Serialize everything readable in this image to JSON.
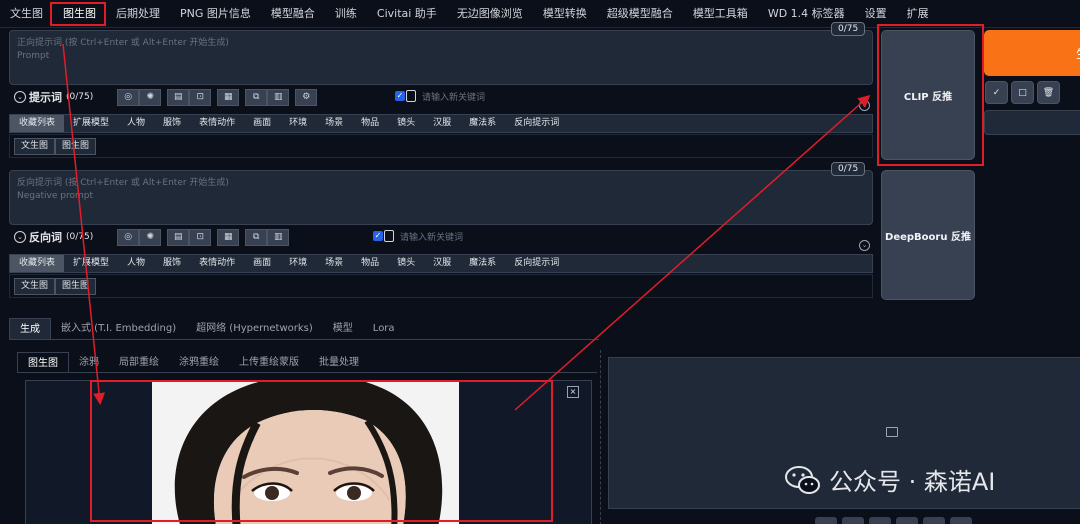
{
  "top_nav": {
    "tabs": [
      "文生图",
      "图生图",
      "后期处理",
      "PNG 图片信息",
      "模型融合",
      "训练",
      "Civitai 助手",
      "无边图像浏览",
      "模型转换",
      "超级模型融合",
      "模型工具箱",
      "WD 1.4 标签器",
      "设置",
      "扩展"
    ],
    "active_index": 1
  },
  "positive": {
    "placeholder": "正向提示词 (按 Ctrl+Enter 或 Alt+Enter 开始生成)",
    "sub_label": "Prompt",
    "counter": "0/75",
    "label": "提示词",
    "count": "(0/75)",
    "keyword_placeholder": "请输入新关键词"
  },
  "negative": {
    "placeholder": "反向提示词 (按 Ctrl+Enter 或 Alt+Enter 开始生成)",
    "sub_label": "Negative prompt",
    "counter": "0/75",
    "label": "反向词",
    "count": "(0/75)",
    "keyword_placeholder": "请输入新关键词"
  },
  "tag_categories": [
    "收藏列表",
    "扩展模型",
    "人物",
    "服饰",
    "表情动作",
    "画面",
    "环境",
    "场景",
    "物品",
    "镜头",
    "汉服",
    "魔法系",
    "反向提示词"
  ],
  "sub_tags": [
    "文生图",
    "图生图"
  ],
  "toolbar_icons": [
    "globe-icon",
    "gear-icon",
    "notes-icon",
    "bookmark-icon",
    "translate-icon",
    "copy-icon",
    "trash-icon",
    "settings-icon"
  ],
  "interrogate": {
    "clip_label": "CLIP 反推",
    "deepbooru_label": "DeepBooru 反推"
  },
  "generate_button_text": "生",
  "action_icons": [
    "✓",
    "□",
    "🗑"
  ],
  "section_tabs": [
    "生成",
    "嵌入式 (T.I. Embedding)",
    "超网络 (Hypernetworks)",
    "模型",
    "Lora"
  ],
  "img2img_tabs": [
    "图生图",
    "涂鸦",
    "局部重绘",
    "涂鸦重绘",
    "上传重绘蒙版",
    "批量处理"
  ],
  "close_glyph": "×",
  "watermark": "公众号 · 森诺AI",
  "accent_colors": {
    "generate": "#f97316",
    "checkbox": "#2563eb",
    "annotation": "#e11d2a"
  }
}
